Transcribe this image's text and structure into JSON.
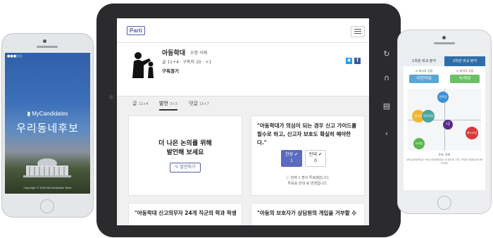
{
  "left_phone": {
    "status_carrier": "●●●○○",
    "status_time": "",
    "status_battery": "",
    "brand": "MyCandidates",
    "title": "우리동네후보",
    "copyright": "Copyright © 2016 MyCandidates Team"
  },
  "tablet": {
    "logo": "Parti",
    "issue": {
      "title": "아동학대",
      "edit_links": "수정 삭제",
      "meta": "글 11+4 · 구독자 10 · +1",
      "subscribe": "구독끊기"
    },
    "tabs": [
      {
        "label": "글",
        "count": "11+4"
      },
      {
        "label": "발언",
        "count": "3+3"
      },
      {
        "label": "댓글",
        "count": "15+7"
      }
    ],
    "cta_card": {
      "line1": "더 나은 논의를 위해",
      "line2": "발언해 보세요",
      "button": "발언하기"
    },
    "opinion_card": {
      "quote": "\"아동학대가 의심이 되는 경우 신고 가이드를 필수로 하고, 신고자 보호도 확실히 해야한다.\"",
      "agree_label": "찬성 ✔",
      "agree_count": "1",
      "oppose_label": "반대 ✔",
      "oppose_count": "0",
      "note1": "현재 1 명이 투표했습니다.",
      "note2": "투표를 반대 로 변경합니다."
    },
    "card3_quote": "\"아동학대 신고의무자 24개 직군의 학과 학생",
    "card4_quote": "\"아동의 보호자가 상담원의 개입을 거부할 수"
  },
  "right_phone": {
    "tab1": "1차원 비교 분석",
    "tab2": "2차원 비교 분석",
    "label_left": "◎ 최고의 공합",
    "label_right": "◎ 최악의 공합",
    "party_left": "국민의당",
    "party_right": "녹색당",
    "dots": [
      "민주당",
      "정의당",
      "국민의당",
      "나",
      "새누리당",
      "녹색당"
    ],
    "axis_label": "X축: 경제",
    "note": "X축(경제정책)과 Y축(사회정책)에서 내 위치와 가장 가까운 정당을 확인해 보세요"
  },
  "colors": {
    "accent": "#5460a8",
    "agree": "#5a6bc0",
    "twitter": "#1da1f2",
    "facebook": "#3b5998",
    "tab_active": "#2f6da8"
  }
}
